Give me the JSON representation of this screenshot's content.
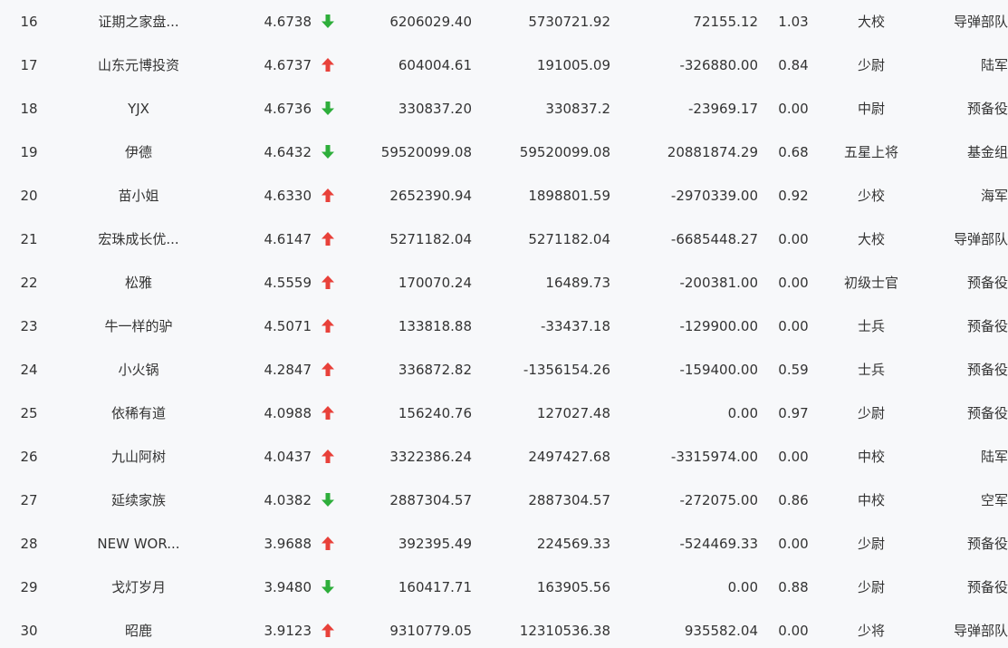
{
  "colors": {
    "up": "#e8413a",
    "down": "#2eae3b",
    "text": "#333333",
    "background": "#f7f8fa"
  },
  "rows": [
    {
      "rank": "16",
      "name": "证期之家盘...",
      "score": "4.6738",
      "trend": "down",
      "v1": "6206029.40",
      "v2": "5730721.92",
      "v3": "72155.12",
      "ratio": "1.03",
      "title": "大校",
      "branch": "导弹部队"
    },
    {
      "rank": "17",
      "name": "山东元博投资",
      "score": "4.6737",
      "trend": "up",
      "v1": "604004.61",
      "v2": "191005.09",
      "v3": "-326880.00",
      "ratio": "0.84",
      "title": "少尉",
      "branch": "陆军"
    },
    {
      "rank": "18",
      "name": "YJX",
      "score": "4.6736",
      "trend": "down",
      "v1": "330837.20",
      "v2": "330837.2",
      "v3": "-23969.17",
      "ratio": "0.00",
      "title": "中尉",
      "branch": "预备役"
    },
    {
      "rank": "19",
      "name": "伊德",
      "score": "4.6432",
      "trend": "down",
      "v1": "59520099.08",
      "v2": "59520099.08",
      "v3": "20881874.29",
      "ratio": "0.68",
      "title": "五星上将",
      "branch": "基金组"
    },
    {
      "rank": "20",
      "name": "苗小姐",
      "score": "4.6330",
      "trend": "up",
      "v1": "2652390.94",
      "v2": "1898801.59",
      "v3": "-2970339.00",
      "ratio": "0.92",
      "title": "少校",
      "branch": "海军"
    },
    {
      "rank": "21",
      "name": "宏珠成长优...",
      "score": "4.6147",
      "trend": "up",
      "v1": "5271182.04",
      "v2": "5271182.04",
      "v3": "-6685448.27",
      "ratio": "0.00",
      "title": "大校",
      "branch": "导弹部队"
    },
    {
      "rank": "22",
      "name": "松雅",
      "score": "4.5559",
      "trend": "up",
      "v1": "170070.24",
      "v2": "16489.73",
      "v3": "-200381.00",
      "ratio": "0.00",
      "title": "初级士官",
      "branch": "预备役"
    },
    {
      "rank": "23",
      "name": "牛一样的驴",
      "score": "4.5071",
      "trend": "up",
      "v1": "133818.88",
      "v2": "-33437.18",
      "v3": "-129900.00",
      "ratio": "0.00",
      "title": "士兵",
      "branch": "预备役"
    },
    {
      "rank": "24",
      "name": "小火锅",
      "score": "4.2847",
      "trend": "up",
      "v1": "336872.82",
      "v2": "-1356154.26",
      "v3": "-159400.00",
      "ratio": "0.59",
      "title": "士兵",
      "branch": "预备役"
    },
    {
      "rank": "25",
      "name": "依稀有道",
      "score": "4.0988",
      "trend": "up",
      "v1": "156240.76",
      "v2": "127027.48",
      "v3": "0.00",
      "ratio": "0.97",
      "title": "少尉",
      "branch": "预备役"
    },
    {
      "rank": "26",
      "name": "九山阿树",
      "score": "4.0437",
      "trend": "up",
      "v1": "3322386.24",
      "v2": "2497427.68",
      "v3": "-3315974.00",
      "ratio": "0.00",
      "title": "中校",
      "branch": "陆军"
    },
    {
      "rank": "27",
      "name": "延续家族",
      "score": "4.0382",
      "trend": "down",
      "v1": "2887304.57",
      "v2": "2887304.57",
      "v3": "-272075.00",
      "ratio": "0.86",
      "title": "中校",
      "branch": "空军"
    },
    {
      "rank": "28",
      "name": "NEW WOR...",
      "score": "3.9688",
      "trend": "up",
      "v1": "392395.49",
      "v2": "224569.33",
      "v3": "-524469.33",
      "ratio": "0.00",
      "title": "少尉",
      "branch": "预备役"
    },
    {
      "rank": "29",
      "name": "戈灯岁月",
      "score": "3.9480",
      "trend": "down",
      "v1": "160417.71",
      "v2": "163905.56",
      "v3": "0.00",
      "ratio": "0.88",
      "title": "少尉",
      "branch": "预备役"
    },
    {
      "rank": "30",
      "name": "昭鹿",
      "score": "3.9123",
      "trend": "up",
      "v1": "9310779.05",
      "v2": "12310536.38",
      "v3": "935582.04",
      "ratio": "0.00",
      "title": "少将",
      "branch": "导弹部队"
    }
  ]
}
